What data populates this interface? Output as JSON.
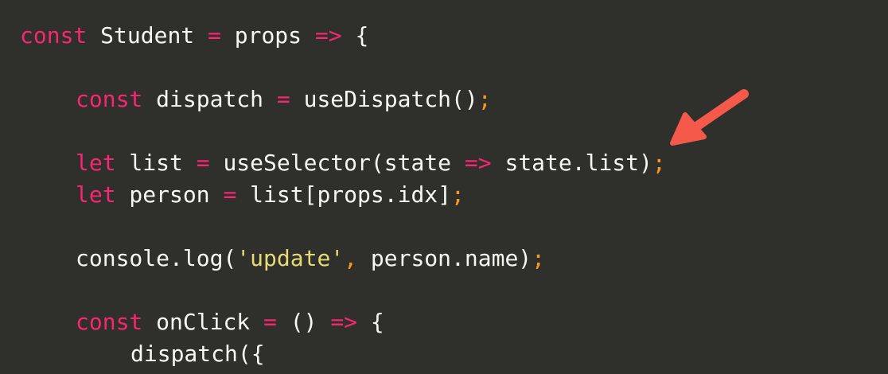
{
  "code": {
    "l1": {
      "kw": "const",
      "ident": " Student ",
      "op1": "=",
      "ident2": " props ",
      "op2": "=>",
      "brace": " {"
    },
    "l3": {
      "kw": "const",
      "ident": " dispatch ",
      "op": "=",
      "call": " useDispatch()",
      "semi": ";"
    },
    "l5": {
      "kw": "let",
      "ident": " list ",
      "op": "=",
      "call1": " useSelector(state ",
      "arrow": "=>",
      "call2": " state.list)",
      "semi": ";"
    },
    "l6": {
      "kw": "let",
      "ident": " person ",
      "op": "=",
      "call": " list[props.idx]",
      "semi": ";"
    },
    "l8": {
      "pre": "console.log(",
      "str": "'update'",
      "comma": ",",
      "post": " person.name)",
      "semi": ";"
    },
    "l10": {
      "kw": "const",
      "ident": " onClick ",
      "op1": "=",
      "parens": " () ",
      "op2": "=>",
      "brace": " {"
    },
    "l11": {
      "call": "dispatch({"
    }
  },
  "colors": {
    "background": "#2f302b",
    "keyword": "#f92672",
    "string": "#e6db74",
    "punctuation": "#fd971f",
    "text": "#f8f8f2",
    "annotation_arrow": "#f5594a"
  },
  "annotation": {
    "icon": "arrow-pointing-left-down-icon"
  }
}
